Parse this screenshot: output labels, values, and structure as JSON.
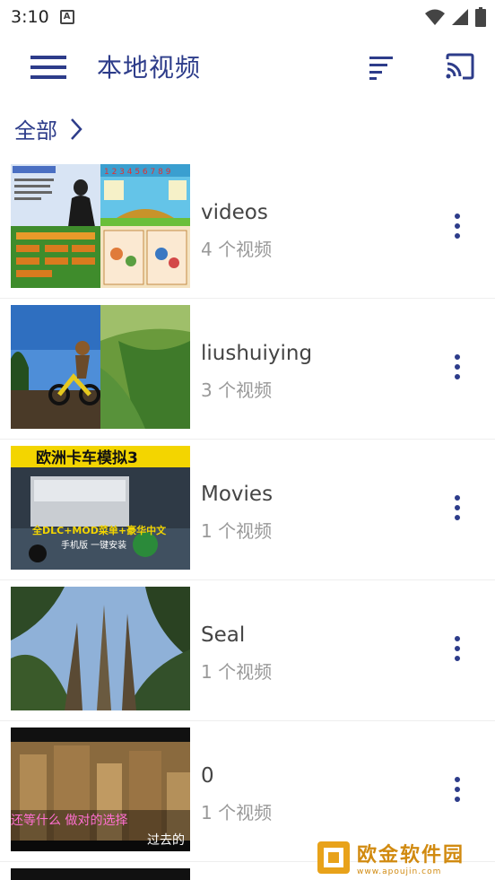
{
  "status_bar": {
    "time": "3:10",
    "notification_icon": "A"
  },
  "app_bar": {
    "title": "本地视频"
  },
  "breadcrumb": {
    "label": "全部"
  },
  "folders": [
    {
      "name": "videos",
      "count": "4 个视频"
    },
    {
      "name": "liushuiying",
      "count": "3 个视频"
    },
    {
      "name": "Movies",
      "count": "1 个视频"
    },
    {
      "name": "Seal",
      "count": "1 个视频"
    },
    {
      "name": "0",
      "count": "1 个视频"
    }
  ],
  "thumbnails": {
    "truck_title": "欧洲卡车模拟3",
    "truck_sub": "全DLC+MOD菜单+豪华中文",
    "truck_caption": "手机版 一键安装",
    "movie_sub1": "还等什么  做对的选择",
    "movie_sub2": "过去的"
  },
  "watermark": {
    "text": "欧金软件园",
    "url": "www.apoujin.com"
  },
  "colors": {
    "accent": "#2d3c8a",
    "watermark": "#d18a10"
  }
}
